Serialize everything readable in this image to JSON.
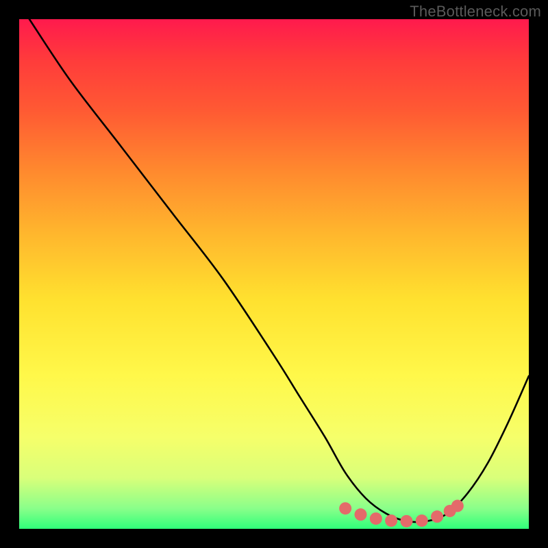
{
  "watermark": "TheBottleneck.com",
  "chart_data": {
    "type": "line",
    "title": "",
    "xlabel": "",
    "ylabel": "",
    "xlim": [
      0,
      100
    ],
    "ylim": [
      0,
      100
    ],
    "grid": false,
    "series": [
      {
        "name": "bottleneck-curve",
        "color": "#000000",
        "x": [
          2,
          10,
          20,
          30,
          40,
          50,
          55,
          60,
          64,
          68,
          72,
          76,
          80,
          84,
          88,
          92,
          96,
          100
        ],
        "y": [
          100,
          88,
          75,
          62,
          49,
          34,
          26,
          18,
          11,
          6,
          3,
          1.5,
          1.5,
          3,
          7,
          13,
          21,
          30
        ]
      }
    ],
    "markers": {
      "name": "optimal-zone",
      "color": "#e46a6a",
      "r": 9,
      "points": [
        {
          "x": 64,
          "y": 4
        },
        {
          "x": 67,
          "y": 2.8
        },
        {
          "x": 70,
          "y": 2
        },
        {
          "x": 73,
          "y": 1.6
        },
        {
          "x": 76,
          "y": 1.5
        },
        {
          "x": 79,
          "y": 1.6
        },
        {
          "x": 82,
          "y": 2.4
        },
        {
          "x": 84.5,
          "y": 3.5
        },
        {
          "x": 86,
          "y": 4.5
        }
      ]
    },
    "gradient_stops": [
      {
        "pos": 0,
        "color": "#ff1a4d"
      },
      {
        "pos": 8,
        "color": "#ff3b3b"
      },
      {
        "pos": 18,
        "color": "#ff5a33"
      },
      {
        "pos": 30,
        "color": "#ff8a2e"
      },
      {
        "pos": 42,
        "color": "#ffb62d"
      },
      {
        "pos": 55,
        "color": "#ffe12f"
      },
      {
        "pos": 70,
        "color": "#fff84a"
      },
      {
        "pos": 82,
        "color": "#f6ff6a"
      },
      {
        "pos": 90,
        "color": "#d9ff7a"
      },
      {
        "pos": 96,
        "color": "#8aff8a"
      },
      {
        "pos": 100,
        "color": "#2fff7a"
      }
    ]
  }
}
